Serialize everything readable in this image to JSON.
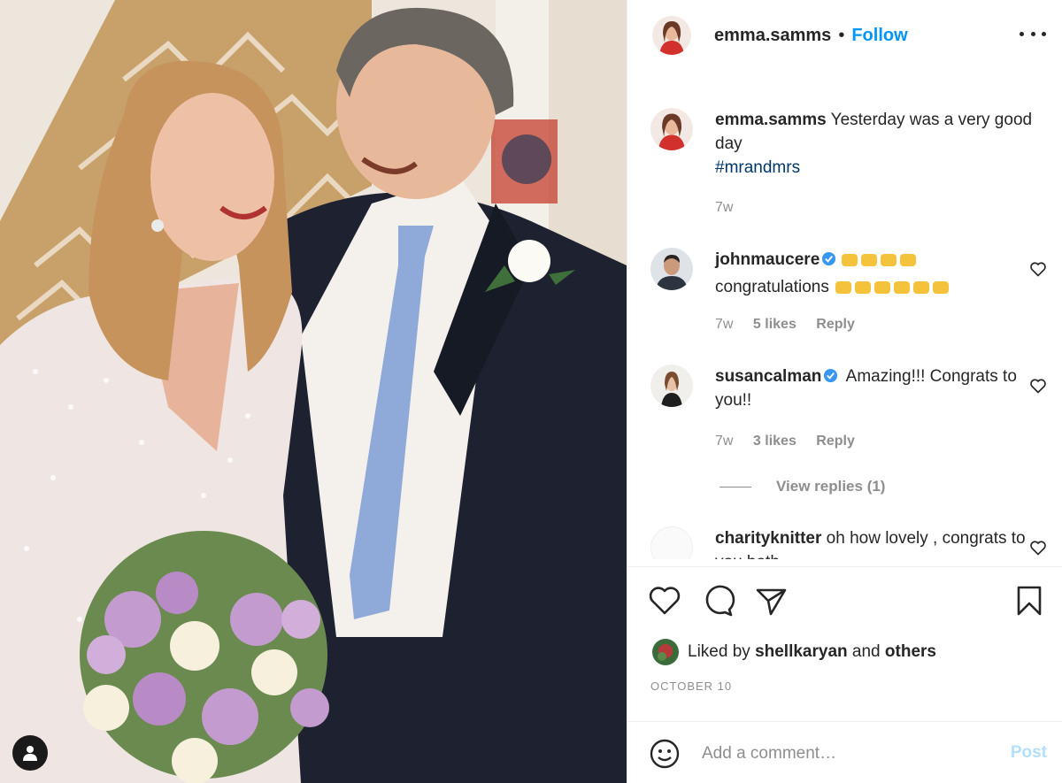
{
  "post": {
    "author": "emma.samms",
    "follow_label": "Follow",
    "separator": "•",
    "caption_text": "Yesterday was a very good day",
    "hashtag": "#mrandmrs",
    "caption_time": "7w"
  },
  "comments": [
    {
      "username": "johnmaucere",
      "verified": true,
      "emoji_icon": "raising-hands-emoji",
      "text": "congratulations",
      "time": "7w",
      "likes": "5 likes",
      "reply": "Reply"
    },
    {
      "username": "susancalman",
      "verified": true,
      "text": "Amazing!!! Congrats to you!!",
      "time": "7w",
      "likes": "3 likes",
      "reply": "Reply"
    },
    {
      "username": "charityknitter",
      "verified": false,
      "text": "oh how lovely , congrats to you both"
    }
  ],
  "view_replies": "View replies (1)",
  "likes": {
    "prefix": "Liked by",
    "user": "shellkaryan",
    "and": "and",
    "others": "others"
  },
  "date": "OCTOBER 10",
  "add_comment": {
    "placeholder": "Add a comment…",
    "post_label": "Post"
  },
  "colors": {
    "accent": "#0095f6",
    "muted": "#8e8e8e",
    "text": "#262626",
    "hashtag": "#00376b",
    "post_disabled": "#b2dffc"
  }
}
